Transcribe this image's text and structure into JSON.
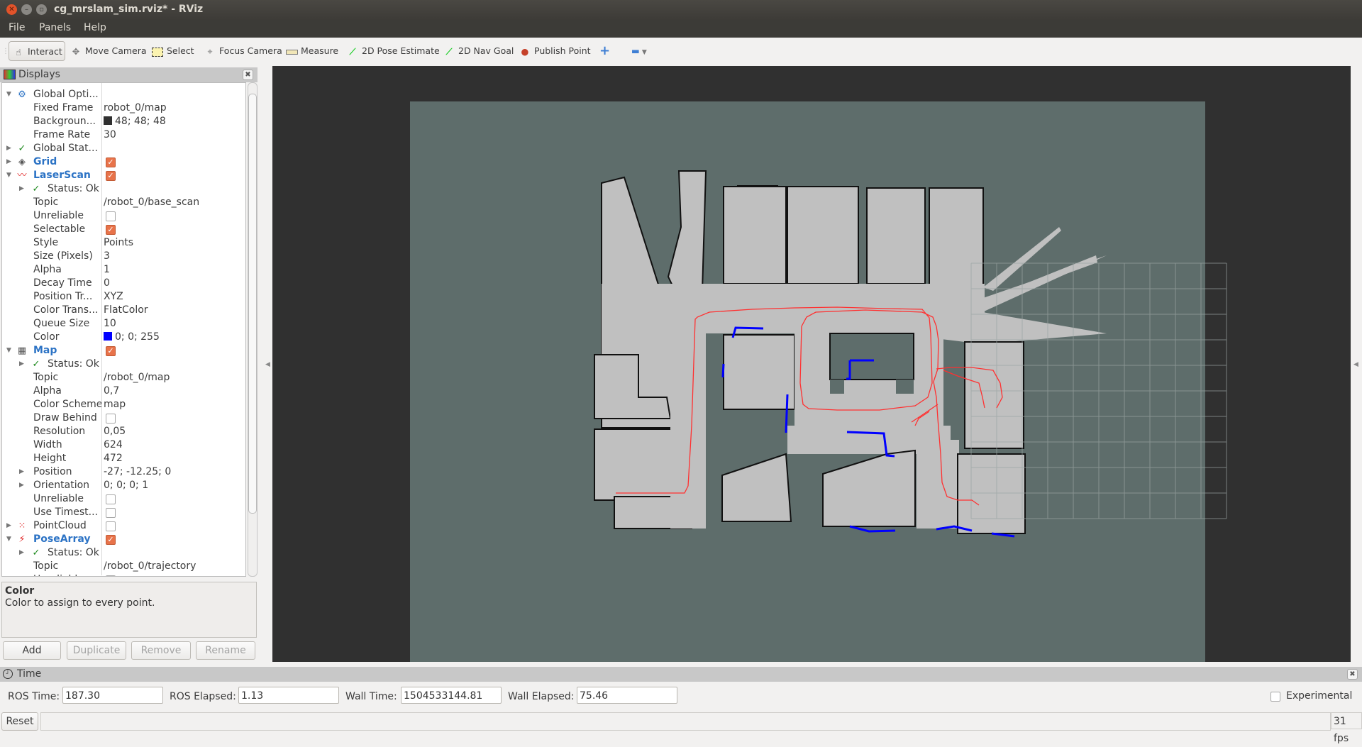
{
  "window": {
    "title": "cg_mrslam_sim.rviz* - RViz"
  },
  "menu": [
    "File",
    "Panels",
    "Help"
  ],
  "toolbar": {
    "tools": [
      {
        "label": "Interact",
        "icon": "hand-icon"
      },
      {
        "label": "Move Camera",
        "icon": "move-camera-icon"
      },
      {
        "label": "Select",
        "icon": "select-icon"
      },
      {
        "label": "Focus Camera",
        "icon": "focus-camera-icon"
      },
      {
        "label": "Measure",
        "icon": "ruler-icon"
      },
      {
        "label": "2D Pose Estimate",
        "icon": "green-arrow-icon"
      },
      {
        "label": "2D Nav Goal",
        "icon": "green-arrow-icon"
      },
      {
        "label": "Publish Point",
        "icon": "map-pin-icon"
      }
    ],
    "add_tool_icon": "plus-icon",
    "remove_tool_icon": "minus-icon"
  },
  "displays": {
    "title": "Displays",
    "rows": [
      {
        "label": "Global Opti...",
        "value": ""
      },
      {
        "label": "Fixed Frame",
        "value": "robot_0/map"
      },
      {
        "label": "Backgroun...",
        "value": "48; 48; 48",
        "swatch": "#303030"
      },
      {
        "label": "Frame Rate",
        "value": "30"
      },
      {
        "label": "Global Stat...",
        "value": ""
      },
      {
        "label": "Grid",
        "checked": true
      },
      {
        "label": "LaserScan",
        "checked": true
      },
      {
        "label": "Status: Ok",
        "value": ""
      },
      {
        "label": "Topic",
        "value": "/robot_0/base_scan"
      },
      {
        "label": "Unreliable",
        "checked": false
      },
      {
        "label": "Selectable",
        "checked": true
      },
      {
        "label": "Style",
        "value": "Points"
      },
      {
        "label": "Size (Pixels)",
        "value": "3"
      },
      {
        "label": "Alpha",
        "value": "1"
      },
      {
        "label": "Decay Time",
        "value": "0"
      },
      {
        "label": "Position Tr...",
        "value": "XYZ"
      },
      {
        "label": "Color Trans...",
        "value": "FlatColor"
      },
      {
        "label": "Queue Size",
        "value": "10"
      },
      {
        "label": "Color",
        "value": "0; 0; 255",
        "swatch": "#0000ff"
      },
      {
        "label": "Map",
        "checked": true
      },
      {
        "label": "Status: Ok",
        "value": ""
      },
      {
        "label": "Topic",
        "value": "/robot_0/map"
      },
      {
        "label": "Alpha",
        "value": "0,7"
      },
      {
        "label": "Color Scheme",
        "value": "map"
      },
      {
        "label": "Draw Behind",
        "checked": false
      },
      {
        "label": "Resolution",
        "value": "0,05"
      },
      {
        "label": "Width",
        "value": "624"
      },
      {
        "label": "Height",
        "value": "472"
      },
      {
        "label": "Position",
        "value": "-27; -12.25; 0"
      },
      {
        "label": "Orientation",
        "value": "0; 0; 0; 1"
      },
      {
        "label": "Unreliable",
        "checked": false
      },
      {
        "label": "Use Timest...",
        "checked": false
      },
      {
        "label": "PointCloud",
        "checked": false
      },
      {
        "label": "PoseArray",
        "checked": true
      },
      {
        "label": "Status: Ok",
        "value": ""
      },
      {
        "label": "Topic",
        "value": "/robot_0/trajectory"
      },
      {
        "label": "Unreliable",
        "checked": false
      }
    ],
    "description": {
      "title": "Color",
      "text": "Color to assign to every point."
    },
    "buttons": {
      "add": "Add",
      "duplicate": "Duplicate",
      "remove": "Remove",
      "rename": "Rename"
    }
  },
  "time": {
    "title": "Time",
    "ros_time_label": "ROS Time:",
    "ros_time": "187.30",
    "ros_elapsed_label": "ROS Elapsed:",
    "ros_elapsed": "1.13",
    "wall_time_label": "Wall Time:",
    "wall_time": "1504533144.81",
    "wall_elapsed_label": "Wall Elapsed:",
    "wall_elapsed": "75.46",
    "experimental_label": "Experimental"
  },
  "status": {
    "reset_label": "Reset",
    "fps": "31 fps"
  },
  "colors": {
    "background": "#303030",
    "map_unknown": "#5e6d6b",
    "map_free": "#c0c0c0",
    "laser": "#0000ff",
    "trajectory": "#ff2020",
    "checkbox_on": "#e8734a",
    "group_label": "#2c73c5"
  }
}
